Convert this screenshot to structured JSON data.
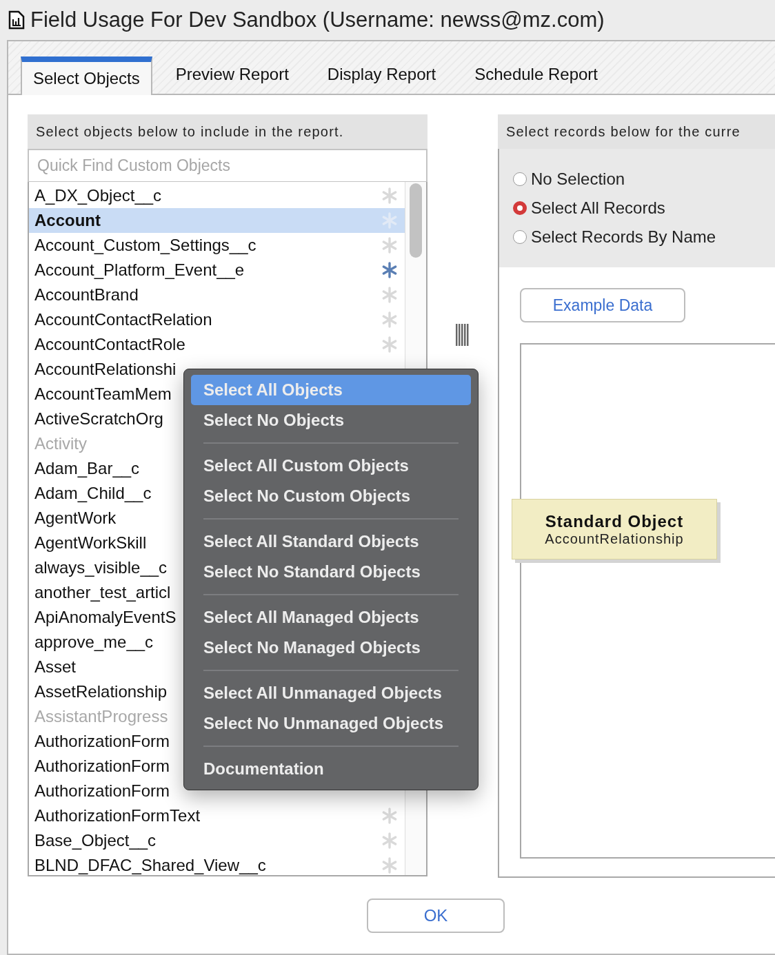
{
  "window": {
    "title": "Field Usage For Dev Sandbox (Username: newss@mz.com)"
  },
  "tabs": [
    {
      "label": "Select Objects",
      "selected": true
    },
    {
      "label": "Preview Report",
      "selected": false
    },
    {
      "label": "Display Report",
      "selected": false
    },
    {
      "label": "Schedule Report",
      "selected": false
    }
  ],
  "objects_panel": {
    "header": "Select objects below to include in the report.",
    "search": {
      "placeholder": "Quick Find Custom Objects"
    },
    "items": [
      {
        "name": "A_DX_Object__c",
        "selected": false,
        "disabled": false,
        "color": "#d9d9d9"
      },
      {
        "name": "Account",
        "selected": true,
        "disabled": false,
        "color": "#e2eaf6"
      },
      {
        "name": "Account_Custom_Settings__c",
        "selected": false,
        "disabled": false,
        "color": "#d9d9d9"
      },
      {
        "name": "Account_Platform_Event__e",
        "selected": false,
        "disabled": false,
        "color": "#5a7fb4"
      },
      {
        "name": "AccountBrand",
        "selected": false,
        "disabled": false,
        "color": "#d9d9d9"
      },
      {
        "name": "AccountContactRelation",
        "selected": false,
        "disabled": false,
        "color": "#d9d9d9"
      },
      {
        "name": "AccountContactRole",
        "selected": false,
        "disabled": false,
        "color": "#d9d9d9"
      },
      {
        "name": "AccountRelationshi",
        "selected": false,
        "disabled": false
      },
      {
        "name": "AccountTeamMem",
        "selected": false,
        "disabled": false
      },
      {
        "name": "ActiveScratchOrg",
        "selected": false,
        "disabled": false
      },
      {
        "name": "Activity",
        "selected": false,
        "disabled": true
      },
      {
        "name": "Adam_Bar__c",
        "selected": false,
        "disabled": false
      },
      {
        "name": "Adam_Child__c",
        "selected": false,
        "disabled": false
      },
      {
        "name": "AgentWork",
        "selected": false,
        "disabled": false
      },
      {
        "name": "AgentWorkSkill",
        "selected": false,
        "disabled": false
      },
      {
        "name": "always_visible__c",
        "selected": false,
        "disabled": false
      },
      {
        "name": "another_test_articl",
        "selected": false,
        "disabled": false
      },
      {
        "name": "ApiAnomalyEventS",
        "selected": false,
        "disabled": false
      },
      {
        "name": "approve_me__c",
        "selected": false,
        "disabled": false
      },
      {
        "name": "Asset",
        "selected": false,
        "disabled": false
      },
      {
        "name": "AssetRelationship",
        "selected": false,
        "disabled": false
      },
      {
        "name": "AssistantProgress",
        "selected": false,
        "disabled": true
      },
      {
        "name": "AuthorizationForm",
        "selected": false,
        "disabled": false
      },
      {
        "name": "AuthorizationForm",
        "selected": false,
        "disabled": false
      },
      {
        "name": "AuthorizationForm",
        "selected": false,
        "disabled": false
      },
      {
        "name": "AuthorizationFormText",
        "selected": false,
        "disabled": false,
        "color": "#d9d9d9"
      },
      {
        "name": "Base_Object__c",
        "selected": false,
        "disabled": false,
        "color": "#d9d9d9"
      },
      {
        "name": "BLND_DFAC_Shared_View__c",
        "selected": false,
        "disabled": false,
        "color": "#d9d9d9"
      }
    ]
  },
  "records_panel": {
    "header": "Select records below for the curre",
    "options": [
      {
        "label": "No Selection",
        "selected": false
      },
      {
        "label": "Select All Records",
        "selected": true
      },
      {
        "label": "Select Records By Name",
        "selected": false
      }
    ],
    "example_button": "Example Data",
    "node": {
      "title": "Standard Object",
      "subtitle": "AccountRelationship"
    }
  },
  "ok_button": "OK",
  "context_menu": {
    "groups": [
      [
        {
          "label": "Select All Objects",
          "selected": true
        },
        {
          "label": "Select No Objects",
          "selected": false
        }
      ],
      [
        {
          "label": "Select All Custom Objects",
          "selected": false
        },
        {
          "label": "Select No Custom Objects",
          "selected": false
        }
      ],
      [
        {
          "label": "Select All Standard Objects",
          "selected": false
        },
        {
          "label": "Select No Standard Objects",
          "selected": false
        }
      ],
      [
        {
          "label": "Select All Managed Objects",
          "selected": false
        },
        {
          "label": "Select No Managed Objects",
          "selected": false
        }
      ],
      [
        {
          "label": "Select All Unmanaged Objects",
          "selected": false
        },
        {
          "label": "Select No Unmanaged Objects",
          "selected": false
        }
      ],
      [
        {
          "label": "Documentation",
          "selected": false
        }
      ]
    ]
  }
}
